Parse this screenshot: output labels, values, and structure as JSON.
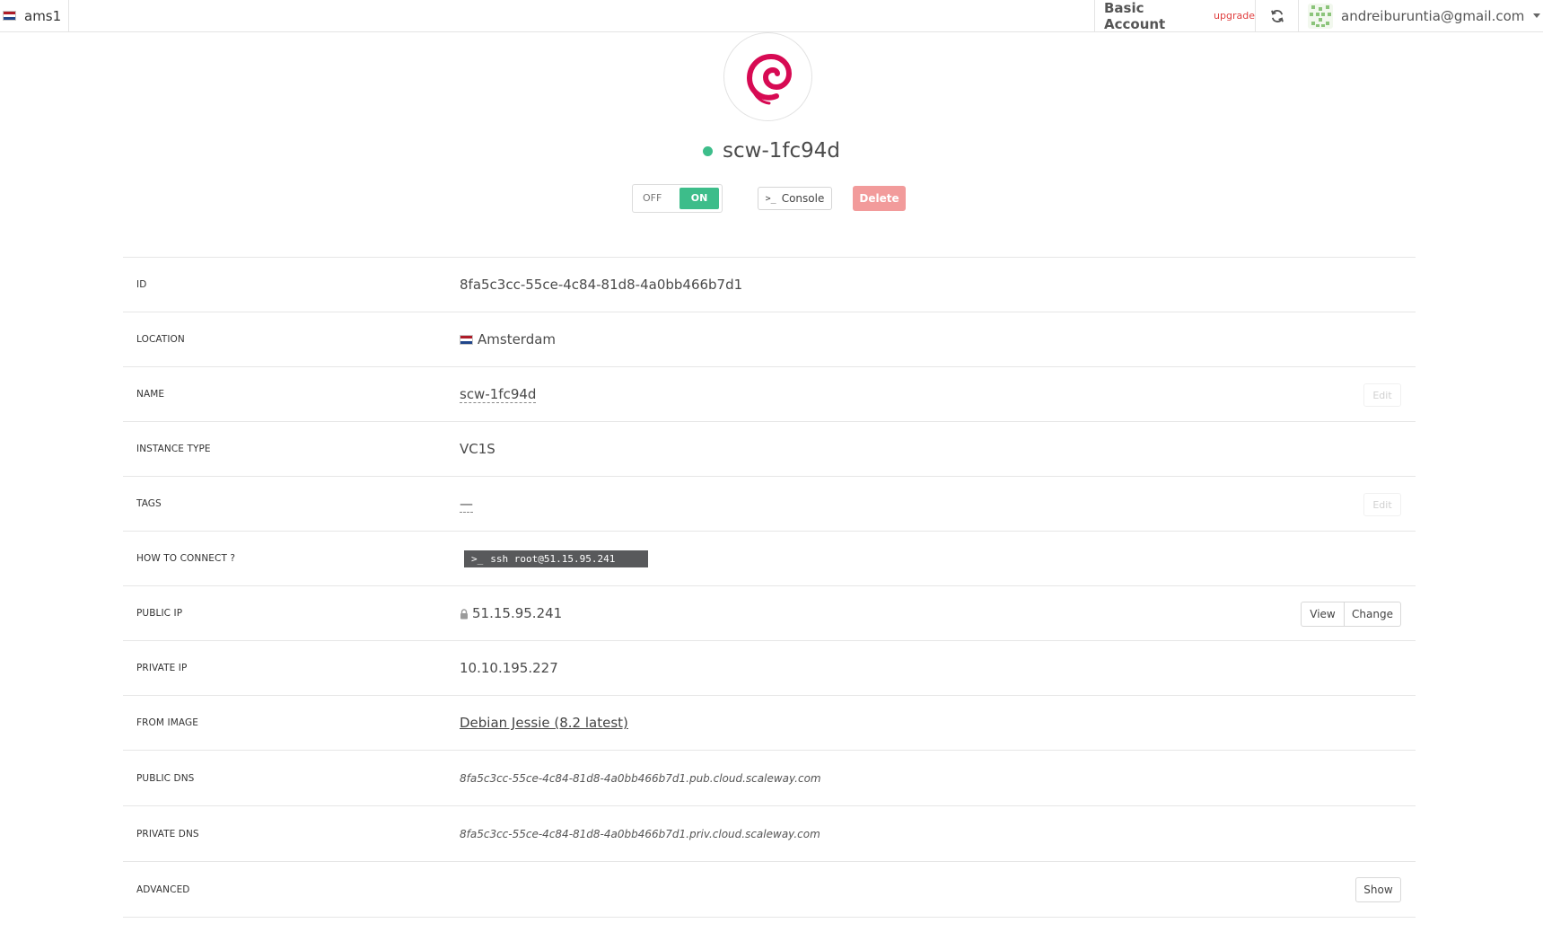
{
  "topbar": {
    "zone_label": "ams1",
    "account_label": "Basic Account",
    "upgrade_label": "upgrade",
    "user_email": "andreiburuntia@gmail.com",
    "icons": {
      "zone_flag": "netherlands-flag-icon",
      "refresh": "refresh-icon",
      "avatar": "identicon-avatar",
      "caret": "caret-down-icon"
    }
  },
  "server": {
    "logo": "debian-logo",
    "status_color": "#3dbd8a",
    "name": "scw-1fc94d",
    "power": {
      "off_label": "OFF",
      "on_label": "ON",
      "state": "on"
    },
    "console_prompt": ">_",
    "console_label": "Console",
    "delete_label": "Delete"
  },
  "details": {
    "id": {
      "label": "ID",
      "value": "8fa5c3cc-55ce-4c84-81d8-4a0bb466b7d1"
    },
    "location": {
      "label": "LOCATION",
      "value": "Amsterdam"
    },
    "name": {
      "label": "NAME",
      "value": "scw-1fc94d",
      "edit_label": "Edit"
    },
    "instance_type": {
      "label": "INSTANCE TYPE",
      "value": "VC1S"
    },
    "tags": {
      "label": "TAGS",
      "value": "—",
      "edit_label": "Edit"
    },
    "how_to_connect": {
      "label": "HOW TO CONNECT ?",
      "prompt": ">_",
      "command": "ssh root@51.15.95.241"
    },
    "public_ip": {
      "label": "PUBLIC IP",
      "value": "51.15.95.241",
      "view_label": "View",
      "change_label": "Change"
    },
    "private_ip": {
      "label": "PRIVATE IP",
      "value": "10.10.195.227"
    },
    "from_image": {
      "label": "FROM IMAGE",
      "value": "Debian Jessie (8.2 latest)"
    },
    "public_dns": {
      "label": "PUBLIC DNS",
      "value": "8fa5c3cc-55ce-4c84-81d8-4a0bb466b7d1.pub.cloud.scaleway.com"
    },
    "private_dns": {
      "label": "PRIVATE DNS",
      "value": "8fa5c3cc-55ce-4c84-81d8-4a0bb466b7d1.priv.cloud.scaleway.com"
    },
    "advanced": {
      "label": "ADVANCED",
      "show_label": "Show"
    }
  }
}
